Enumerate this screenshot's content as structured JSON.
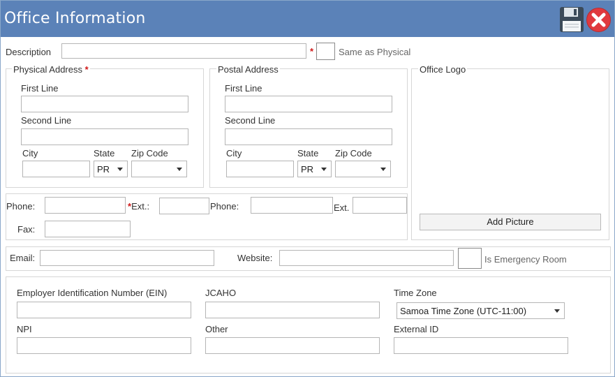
{
  "window": {
    "title": "Office Information"
  },
  "toolbar": {
    "save_icon": "save-icon",
    "close_icon": "close-icon"
  },
  "description": {
    "label": "Description",
    "required_mark": "*",
    "value": ""
  },
  "same_as_physical": {
    "label": "Same as Physical",
    "checked": false
  },
  "physical_address": {
    "legend": "Physical Address",
    "required_mark": "*",
    "first_line_label": "First Line",
    "second_line_label": "Second Line",
    "city_label": "City",
    "state_label": "State",
    "zip_label": "Zip Code",
    "state_value": "PR",
    "zip_value": ""
  },
  "postal_address": {
    "legend": "Postal Address",
    "first_line_label": "First Line",
    "second_line_label": "Second Line",
    "city_label": "City",
    "state_label": "State",
    "zip_label": "Zip Code",
    "state_value": "PR",
    "zip_value": ""
  },
  "office_logo": {
    "legend": "Office Logo",
    "add_picture_label": "Add Picture"
  },
  "contact": {
    "phone_label": "Phone:",
    "ext_required_mark": "*",
    "ext_label": "Ext.:",
    "phone2_label": "Phone:",
    "ext2_label": "Ext.",
    "fax_label": "Fax:"
  },
  "web": {
    "email_label": "Email:",
    "website_label": "Website:",
    "emergency_label": "Is Emergency Room",
    "emergency_checked": false
  },
  "ids": {
    "ein_label": "Employer Identification Number (EIN)",
    "jcaho_label": "JCAHO",
    "timezone_label": "Time Zone",
    "timezone_value": "Samoa Time Zone (UTC-11:00)",
    "npi_label": "NPI",
    "other_label": "Other",
    "external_id_label": "External ID"
  },
  "colors": {
    "titlebar": "#5b82b8",
    "required": "#d01818",
    "close": "#e0393e"
  }
}
